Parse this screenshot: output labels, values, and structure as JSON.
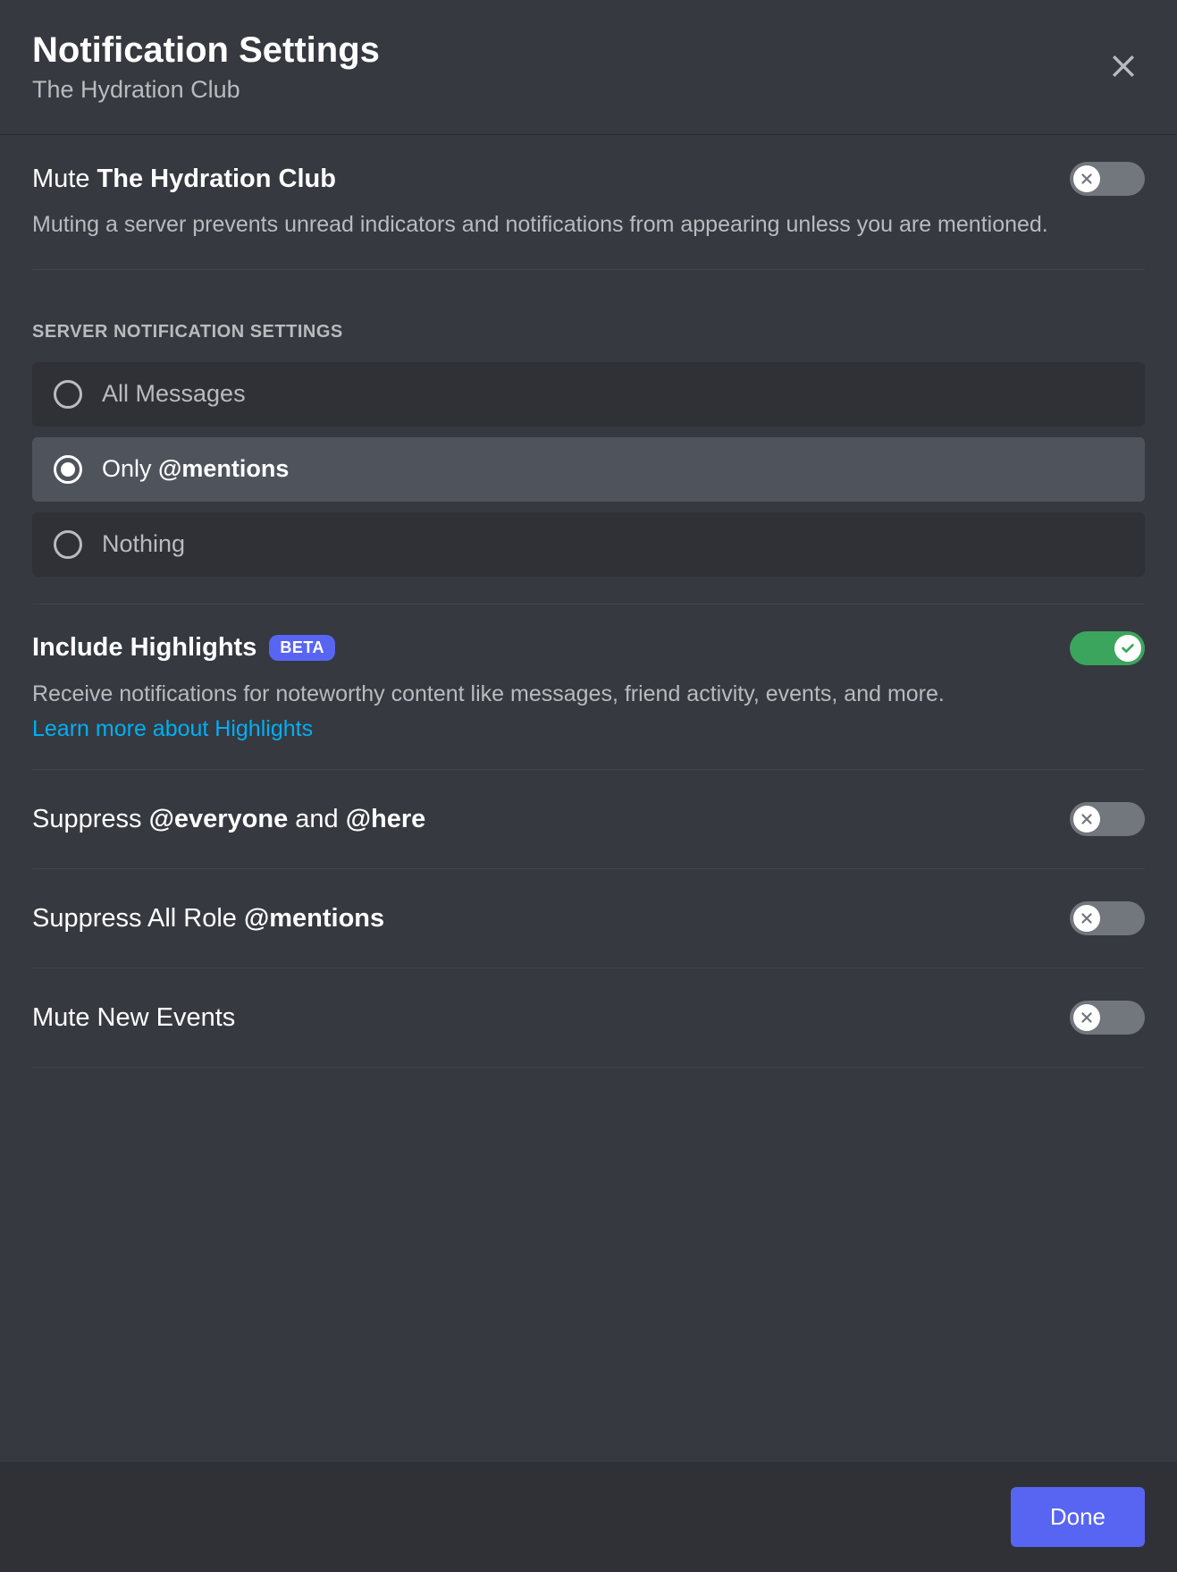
{
  "header": {
    "title": "Notification Settings",
    "subtitle": "The Hydration Club"
  },
  "mute_section": {
    "prefix": "Mute ",
    "server_name": "The Hydration Club",
    "description": "Muting a server prevents unread indicators and notifications from appearing unless you are mentioned.",
    "enabled": false
  },
  "radio_section": {
    "header": "SERVER NOTIFICATION SETTINGS",
    "options": [
      {
        "label_plain": "All Messages",
        "label_bold": "",
        "selected": false
      },
      {
        "label_plain": "Only ",
        "label_bold": "@mentions",
        "selected": true
      },
      {
        "label_plain": "Nothing",
        "label_bold": "",
        "selected": false
      }
    ]
  },
  "highlights": {
    "title": "Include Highlights",
    "badge": "BETA",
    "description": "Receive notifications for noteworthy content like messages, friend activity, events, and more.",
    "link": "Learn more about Highlights",
    "enabled": true
  },
  "suppress_everyone": {
    "prefix1": "Suppress ",
    "bold1": "@everyone",
    "mid": " and ",
    "bold2": "@here",
    "enabled": false
  },
  "suppress_roles": {
    "prefix": "Suppress All Role ",
    "bold": "@mentions",
    "enabled": false
  },
  "mute_events": {
    "label": "Mute New Events",
    "enabled": false
  },
  "footer": {
    "done": "Done"
  }
}
